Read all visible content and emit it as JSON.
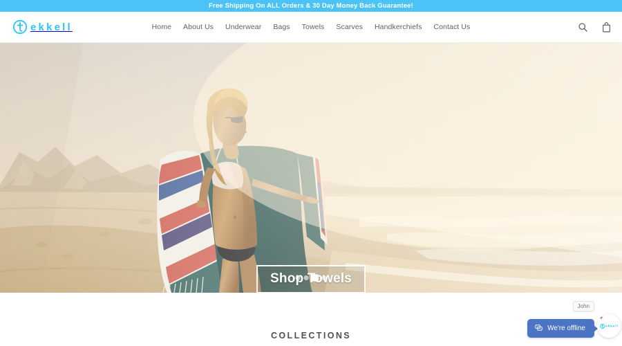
{
  "announcement": {
    "text": "Free Shipping On ALL Orders & 30 Day Money Back Guarantee!",
    "background_color": "#4cc3f7",
    "text_color": "#ffffff"
  },
  "header": {
    "logo": {
      "text": "ekkell",
      "mark": "tekkell-circle-t-icon",
      "color": "#2ec4f5"
    },
    "nav": [
      {
        "label": "Home"
      },
      {
        "label": "About Us"
      },
      {
        "label": "Underwear"
      },
      {
        "label": "Bags"
      },
      {
        "label": "Towels"
      },
      {
        "label": "Scarves"
      },
      {
        "label": "Handkerchiefs"
      },
      {
        "label": "Contact Us"
      }
    ],
    "actions": [
      {
        "icon": "search-icon",
        "label": "Search"
      },
      {
        "icon": "shopping-bag-icon",
        "label": "Cart"
      }
    ]
  },
  "hero": {
    "cta_label": "Shop Towels",
    "scene": "Woman on a sunlit beach holding a striped teal Turkish towel, dunes at left and ocean waves at right",
    "slides_total": 4,
    "active_slide": 3
  },
  "main": {
    "section_title": "COLLECTIONS"
  },
  "chat": {
    "agent_name": "John",
    "button_label": "We're offline",
    "button_color": "#4b74c4",
    "icon": "chat-bubble-icon",
    "avatar": "tekkell-logo-avatar"
  }
}
